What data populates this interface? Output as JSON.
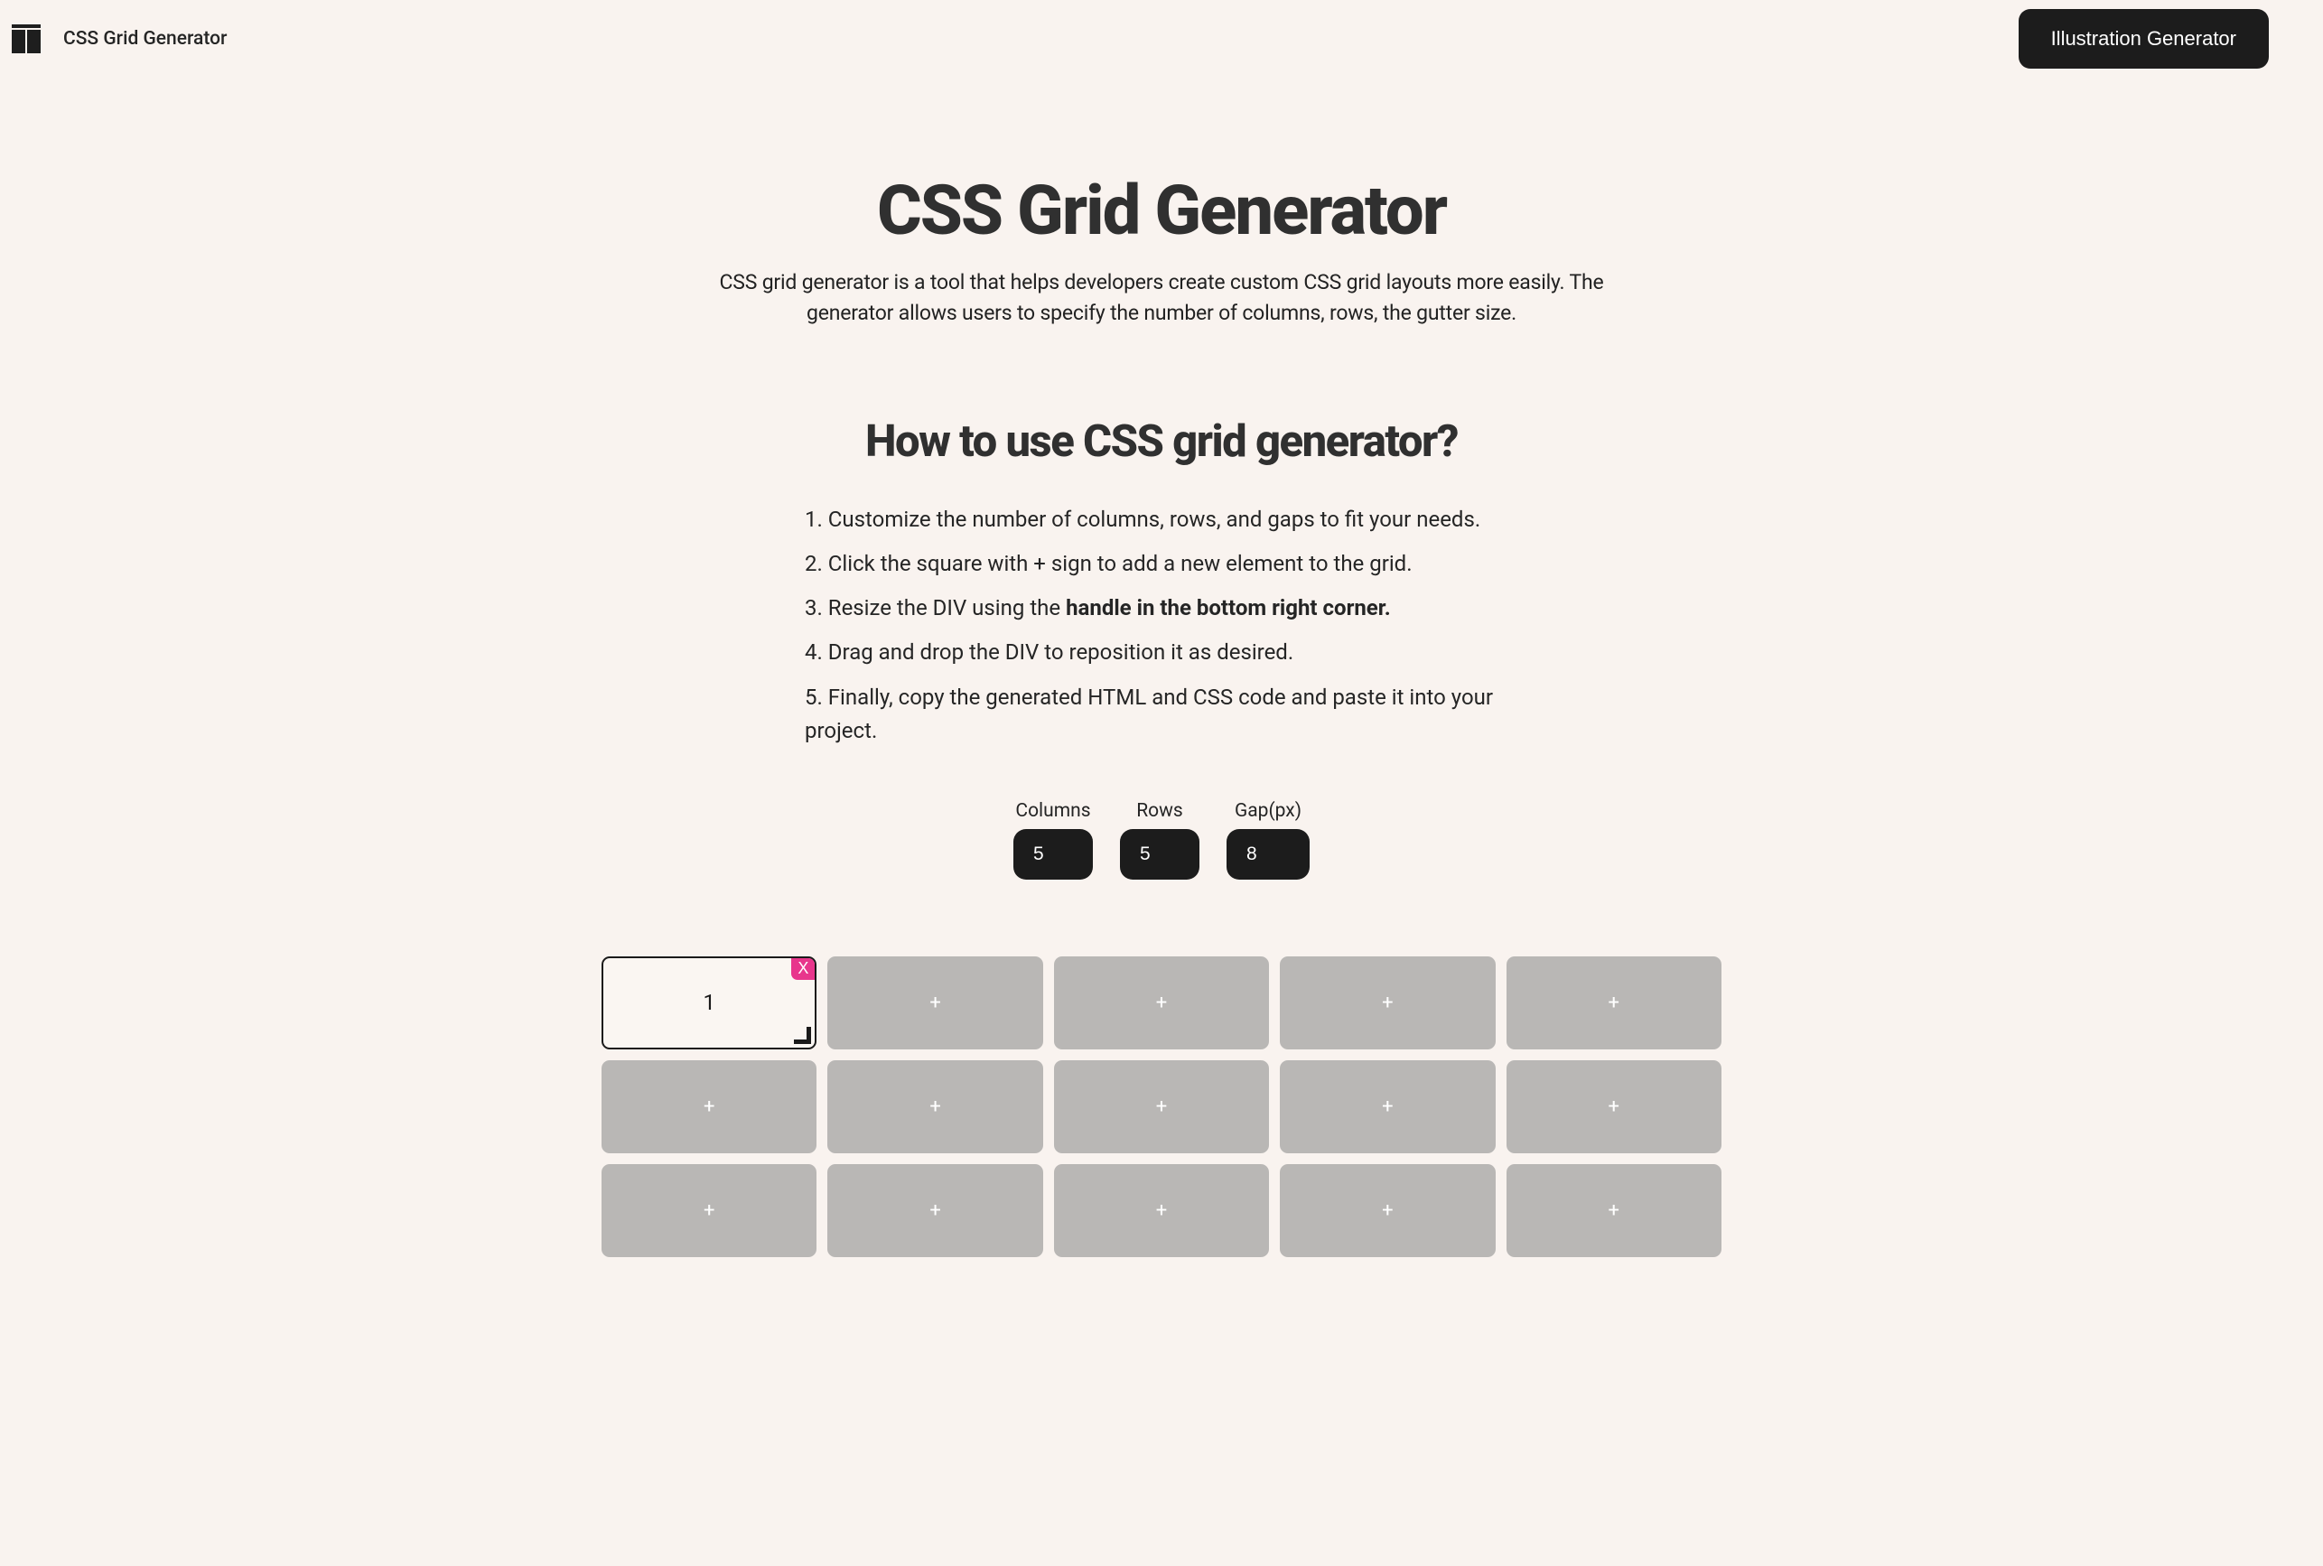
{
  "header": {
    "app_name": "CSS Grid Generator",
    "cta_label": "Illustration Generator"
  },
  "hero": {
    "title": "CSS Grid Generator",
    "description": "CSS grid generator is a tool that helps developers create custom CSS grid layouts more easily. The generator allows users to specify the number of columns, rows, the gutter size."
  },
  "howto": {
    "title": "How to use CSS grid generator?",
    "steps": [
      {
        "prefix": "1. ",
        "text": "Customize the number of columns, rows, and gaps to fit your needs."
      },
      {
        "prefix": "2. ",
        "text": "Click the square with + sign to add a new element to the grid."
      },
      {
        "prefix": "3. ",
        "text_pre": "Resize the DIV using the ",
        "strong": "handle in the bottom right corner."
      },
      {
        "prefix": "4. ",
        "text": "Drag and drop the DIV to reposition it as desired."
      },
      {
        "prefix": "5. ",
        "text": "Finally, copy the generated HTML and CSS code and paste it into your project."
      }
    ]
  },
  "controls": {
    "columns_label": "Columns",
    "columns_value": "5",
    "rows_label": "Rows",
    "rows_value": "5",
    "gap_label": "Gap(px)",
    "gap_value": "8"
  },
  "grid": {
    "columns": 5,
    "rows_visible": 3,
    "div_label": "1",
    "div_close": "X",
    "plus": "+"
  }
}
